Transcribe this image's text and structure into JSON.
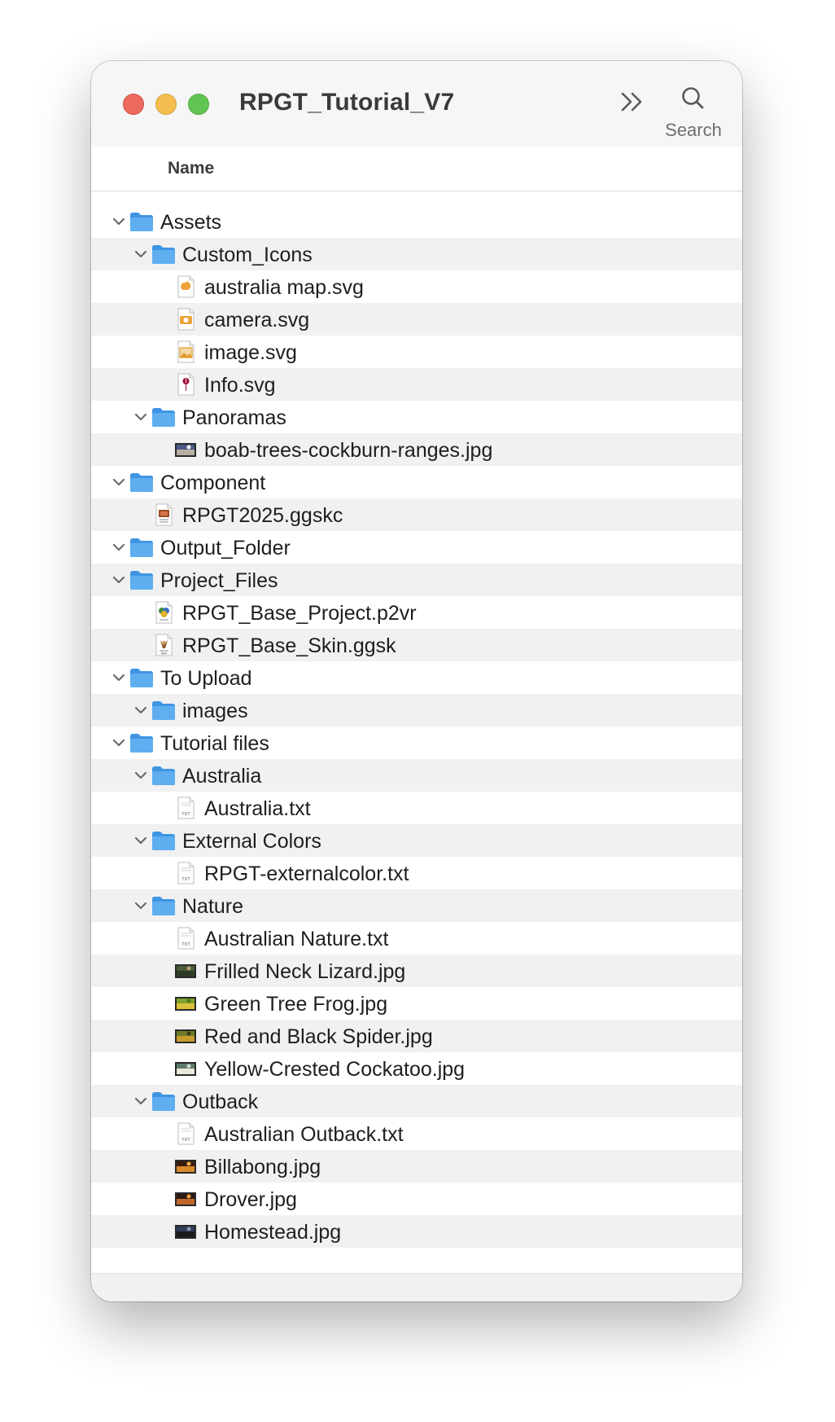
{
  "window": {
    "title": "RPGT_Tutorial_V7",
    "toolbar": {
      "search_label": "Search"
    },
    "column_header": "Name"
  },
  "colors": {
    "folder": "#5eaef0",
    "folder_dark": "#3f95e3",
    "close": "#ed6a5e",
    "minimize": "#f5bf4f",
    "zoom": "#61c554"
  },
  "rows": [
    {
      "label": "Assets",
      "depth": 0,
      "kind": "folder",
      "expanded": true
    },
    {
      "label": "Custom_Icons",
      "depth": 1,
      "kind": "folder",
      "expanded": true
    },
    {
      "label": "australia map.svg",
      "depth": 2,
      "kind": "svg-map"
    },
    {
      "label": "camera.svg",
      "depth": 2,
      "kind": "svg-camera"
    },
    {
      "label": "image.svg",
      "depth": 2,
      "kind": "svg-image"
    },
    {
      "label": "Info.svg",
      "depth": 2,
      "kind": "svg-info"
    },
    {
      "label": "Panoramas",
      "depth": 1,
      "kind": "folder",
      "expanded": true
    },
    {
      "label": "boab-trees-cockburn-ranges.jpg",
      "depth": 2,
      "kind": "jpg-pano"
    },
    {
      "label": "Component",
      "depth": 0,
      "kind": "folder",
      "expanded": true
    },
    {
      "label": "RPGT2025.ggskc",
      "depth": 1,
      "kind": "ggskc"
    },
    {
      "label": "Output_Folder",
      "depth": 0,
      "kind": "folder",
      "expanded": true
    },
    {
      "label": "Project_Files",
      "depth": 0,
      "kind": "folder",
      "expanded": true
    },
    {
      "label": "RPGT_Base_Project.p2vr",
      "depth": 1,
      "kind": "p2vr"
    },
    {
      "label": "RPGT_Base_Skin.ggsk",
      "depth": 1,
      "kind": "ggsk"
    },
    {
      "label": "To Upload",
      "depth": 0,
      "kind": "folder",
      "expanded": true
    },
    {
      "label": "images",
      "depth": 1,
      "kind": "folder",
      "expanded": true
    },
    {
      "label": "Tutorial files",
      "depth": 0,
      "kind": "folder",
      "expanded": true
    },
    {
      "label": "Australia",
      "depth": 1,
      "kind": "folder",
      "expanded": true
    },
    {
      "label": "Australia.txt",
      "depth": 2,
      "kind": "txt"
    },
    {
      "label": "External Colors",
      "depth": 1,
      "kind": "folder",
      "expanded": true
    },
    {
      "label": "RPGT-externalcolor.txt",
      "depth": 2,
      "kind": "txt"
    },
    {
      "label": "Nature",
      "depth": 1,
      "kind": "folder",
      "expanded": true
    },
    {
      "label": "Australian Nature.txt",
      "depth": 2,
      "kind": "txt"
    },
    {
      "label": "Frilled Neck Lizard.jpg",
      "depth": 2,
      "kind": "jpg-lizard"
    },
    {
      "label": "Green Tree Frog.jpg",
      "depth": 2,
      "kind": "jpg-frog"
    },
    {
      "label": "Red and Black Spider.jpg",
      "depth": 2,
      "kind": "jpg-spider"
    },
    {
      "label": "Yellow-Crested Cockatoo.jpg",
      "depth": 2,
      "kind": "jpg-cockatoo"
    },
    {
      "label": "Outback",
      "depth": 1,
      "kind": "folder",
      "expanded": true
    },
    {
      "label": "Australian Outback.txt",
      "depth": 2,
      "kind": "txt"
    },
    {
      "label": "Billabong.jpg",
      "depth": 2,
      "kind": "jpg-billabong"
    },
    {
      "label": "Drover.jpg",
      "depth": 2,
      "kind": "jpg-drover"
    },
    {
      "label": "Homestead.jpg",
      "depth": 2,
      "kind": "jpg-homestead"
    }
  ]
}
